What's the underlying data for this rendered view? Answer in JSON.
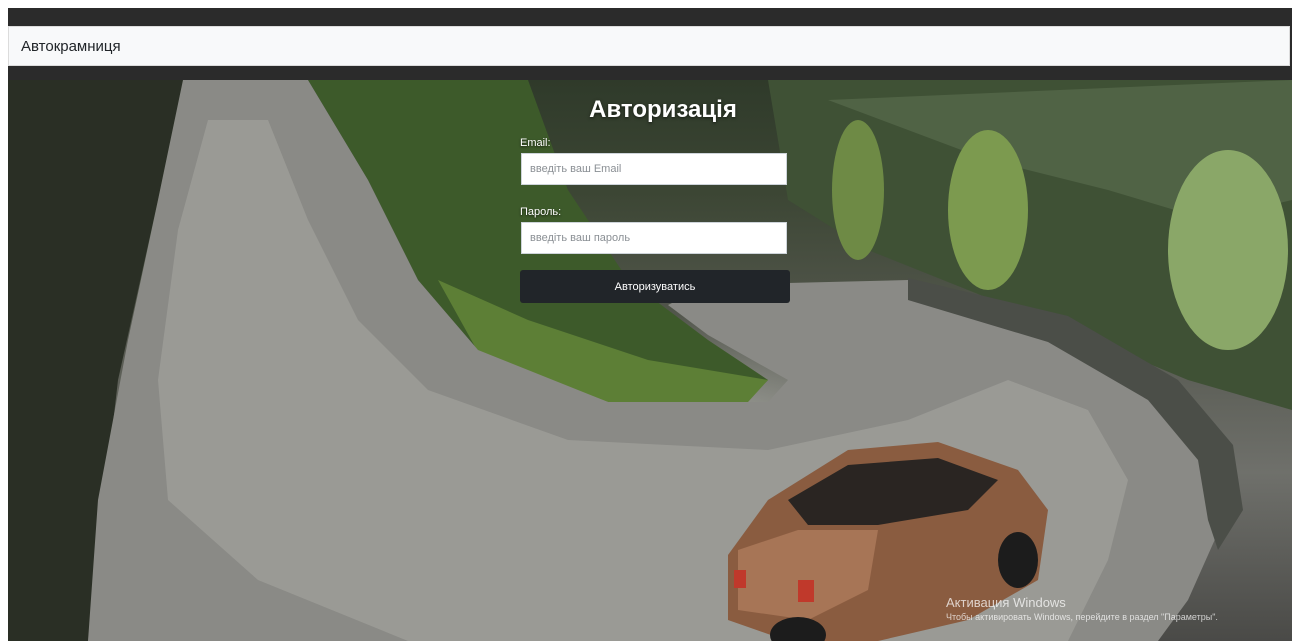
{
  "navbar": {
    "brand": "Автокрамниця"
  },
  "login": {
    "title": "Авторизація",
    "email_label": "Email:",
    "email_placeholder": "введіть ваш Email",
    "email_value": "",
    "password_label": "Пароль:",
    "password_placeholder": "введіть ваш пароль",
    "password_value": "",
    "submit_label": "Авторизуватись"
  },
  "watermark": {
    "title": "Активация Windows",
    "subtitle": "Чтобы активировать Windows, перейдите в раздел \"Параметры\"."
  },
  "colors": {
    "navbar_bg": "#f8f9fa",
    "button_bg": "#212529",
    "frame_bg": "#2b2b2b"
  }
}
